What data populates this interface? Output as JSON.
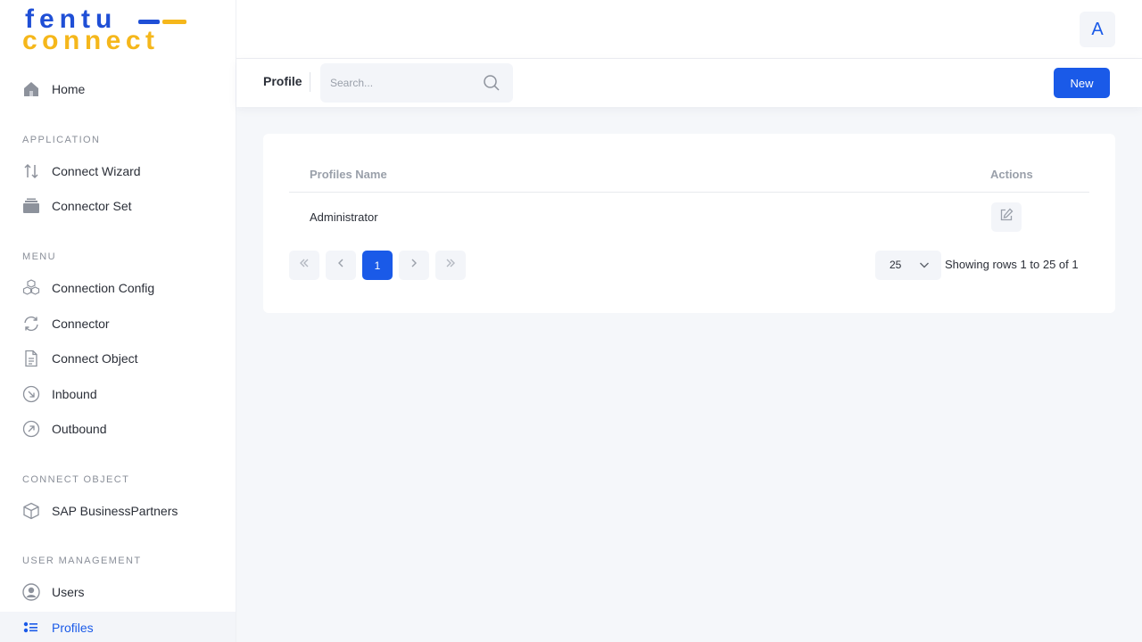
{
  "brand": {
    "line1": "fentu",
    "line2": "connect",
    "blue": "#1f4fd6",
    "yellow": "#f5b71b"
  },
  "sidebar": {
    "home": {
      "label": "Home",
      "icon": "home-icon"
    },
    "sections": [
      {
        "title": "APPLICATION"
      },
      {
        "title": "MENU"
      },
      {
        "title": "CONNECT OBJECT"
      },
      {
        "title": "USER MANAGEMENT"
      }
    ],
    "items": [
      {
        "label": "Connect Wizard",
        "icon": "arrows-up-down-icon"
      },
      {
        "label": "Connector Set",
        "icon": "stack-icon"
      },
      {
        "label": "Connection Config",
        "icon": "cubes-icon"
      },
      {
        "label": "Connector",
        "icon": "sync-icon"
      },
      {
        "label": "Connect Object",
        "icon": "document-icon"
      },
      {
        "label": "Inbound",
        "icon": "arrow-down-right-circle-icon"
      },
      {
        "label": "Outbound",
        "icon": "arrow-up-right-circle-icon"
      },
      {
        "label": "SAP BusinessPartners",
        "icon": "box-icon"
      },
      {
        "label": "Users",
        "icon": "user-circle-icon"
      },
      {
        "label": "Profiles",
        "icon": "list-icon"
      }
    ]
  },
  "header": {
    "avatar_initial": "A"
  },
  "toolbar": {
    "page_title": "Profile",
    "search_placeholder": "Search...",
    "new_label": "New"
  },
  "table": {
    "headers": {
      "name": "Profiles Name",
      "actions": "Actions"
    },
    "rows": [
      {
        "name": "Administrator"
      }
    ]
  },
  "pagination": {
    "current_page": "1",
    "page_size": "25",
    "summary": "Showing rows 1 to 25 of 1"
  },
  "colors": {
    "accent": "#1a5ae8",
    "page_bg": "#f5f7fa"
  }
}
